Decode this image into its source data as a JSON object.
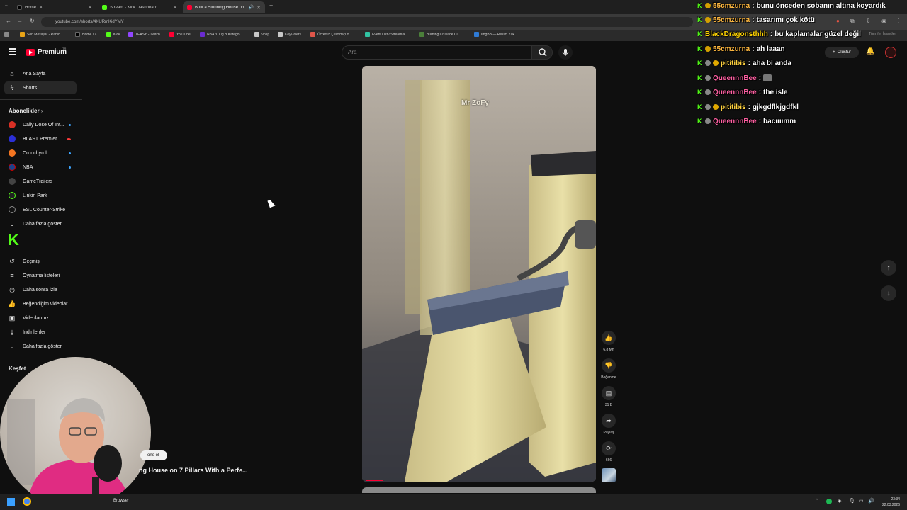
{
  "browser": {
    "tabs": [
      {
        "title": "Home / X",
        "color": "#000000",
        "active": false
      },
      {
        "title": "Stream - Kick Dashboard",
        "color": "#53fc18",
        "active": false
      },
      {
        "title": "Built a Stunning House on",
        "color": "#ff0033",
        "active": true
      }
    ],
    "url": "youtube.com/shorts/4XURmKidYMY",
    "bookmarks": [
      {
        "label": "Son Mesajlar - Rabic...",
        "color": "#e8a317"
      },
      {
        "label": "Home / X",
        "color": "#000000"
      },
      {
        "label": "Kick",
        "color": "#53fc18"
      },
      {
        "label": "TEASY - Twitch",
        "color": "#9146ff"
      },
      {
        "label": "YouTube",
        "color": "#ff0033"
      },
      {
        "label": "NBA 3. Lig B Katego...",
        "color": "#6a2bd1"
      },
      {
        "label": "Vosp",
        "color": "#c8c8c8"
      },
      {
        "label": "KeyGivers",
        "color": "#c8c8c8"
      },
      {
        "label": "Ücretsiz Çevrimiçi Y...",
        "color": "#e0564a"
      },
      {
        "label": "Event List / Streamla...",
        "color": "#31c3a2"
      },
      {
        "label": "Burning Crusade Cl...",
        "color": "#4b7f3a"
      },
      {
        "label": "ImgBB — Resim Yük...",
        "color": "#2f7bd6"
      }
    ],
    "right_hint": "Tüm Yer İşaretleri"
  },
  "youtube": {
    "logo_text": "Premium",
    "logo_tr": "TR",
    "search_placeholder": "Ara",
    "create_label": "Oluştur",
    "sidebar": {
      "main": [
        {
          "label": "Ana Sayfa",
          "icon": "home-icon"
        },
        {
          "label": "Shorts",
          "icon": "shorts-icon",
          "active": true
        }
      ],
      "subs_heading": "Abonelikler",
      "subs": [
        {
          "label": "Daily Dose Of Int...",
          "color": "#d93025",
          "dot": true
        },
        {
          "label": "BLAST Premier",
          "color": "#2b2fd6",
          "dot": true
        },
        {
          "label": "Crunchyroll",
          "color": "#f47521",
          "dot": true
        },
        {
          "label": "NBA",
          "color": "#1d428a",
          "dot": true
        },
        {
          "label": "GameTrailers",
          "color": "#444444",
          "dot": false
        },
        {
          "label": "Linkin Park",
          "color": "#222222",
          "dot": false
        },
        {
          "label": "ESL Counter-Strike",
          "color": "#111111",
          "dot": false
        }
      ],
      "show_more": "Daha fazla göster",
      "you_items": [
        {
          "label": "Geçmiş",
          "icon": "history-icon"
        },
        {
          "label": "Oynatma listeleri",
          "icon": "playlist-icon"
        },
        {
          "label": "Daha sonra izle",
          "icon": "clock-icon"
        },
        {
          "label": "Beğendiğim videolar",
          "icon": "thumbs-up-icon"
        },
        {
          "label": "Videolarınız",
          "icon": "video-icon"
        },
        {
          "label": "İndirilenler",
          "icon": "download-icon"
        }
      ],
      "show_more2": "Daha fazla göster",
      "explore_heading": "Keşfet"
    },
    "video": {
      "watermark": "Mr ZoFy",
      "title": "ng House on 7 Pillars With a Perfe...",
      "join_label": "one ol",
      "progress_fraction": 0.07
    },
    "actions": [
      {
        "name": "like",
        "icon": "thumbs-up-icon",
        "label": "6,8 Mn"
      },
      {
        "name": "dislike",
        "icon": "thumbs-down-icon",
        "label": "Beğenme"
      },
      {
        "name": "comments",
        "icon": "comment-icon",
        "label": "31 B"
      },
      {
        "name": "share",
        "icon": "share-icon",
        "label": "Paylaş"
      },
      {
        "name": "remix",
        "icon": "remix-icon",
        "label": "666"
      }
    ]
  },
  "chat": [
    {
      "user": "55cmzurna",
      "color": "#ffb83f",
      "msg": "bunu önceden sobanın altına koyardık",
      "badge": "#d4a000"
    },
    {
      "user": "55cmzurna",
      "color": "#ffb83f",
      "msg": "tasarımı çok kötü",
      "badge": "#d4a000"
    },
    {
      "user": "BlackDragonsthhh",
      "color": "#ffd400",
      "msg": "bu kaplamalar güzel değil",
      "badge": ""
    },
    {
      "user": "55cmzurna",
      "color": "#ffb83f",
      "msg": "ah laaan",
      "badge": "#d4a000"
    },
    {
      "user": "pititibis",
      "color": "#ffd23f",
      "msg": "aha bi anda",
      "badge": "#e0a800"
    },
    {
      "user": "QueennnBee",
      "color": "#ff5fa2",
      "msg": "",
      "badge": "#888888"
    },
    {
      "user": "QueennnBee",
      "color": "#ff5fa2",
      "msg": "the isle",
      "badge": "#888888"
    },
    {
      "user": "pititibis",
      "color": "#ffd23f",
      "msg": "gjkgdflkjgdfkl",
      "badge": "#e0a800"
    },
    {
      "user": "QueennnBee",
      "color": "#ff5fa2",
      "msg": "bacıııımm",
      "badge": "#888888"
    }
  ],
  "taskbar": {
    "app_label": "Browser",
    "time": "23:34",
    "date": "22.03.2026"
  }
}
